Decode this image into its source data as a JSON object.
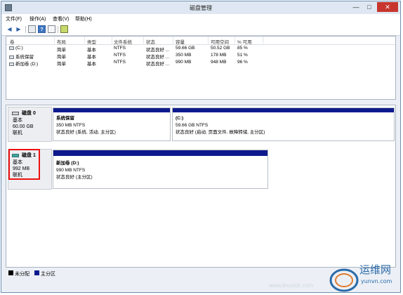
{
  "window": {
    "title": "磁盘管理",
    "minimize": "—",
    "maximize": "□",
    "close": "✕"
  },
  "menu": [
    "文件(F)",
    "操作(A)",
    "查看(V)",
    "帮助(H)"
  ],
  "toolbar_icons": [
    "back-icon",
    "forward-icon",
    "properties-icon",
    "help-icon",
    "disk-icon"
  ],
  "volume_list": {
    "columns": [
      "卷",
      "布局",
      "类型",
      "文件系统",
      "状态",
      "容量",
      "可用空间",
      "% 可用"
    ],
    "rows": [
      [
        "(C:)",
        "简单",
        "基本",
        "NTFS",
        "状态良好 ...",
        "59.66 GB",
        "50.52 GB",
        "85 %"
      ],
      [
        "系统保留",
        "简单",
        "基本",
        "NTFS",
        "状态良好 ...",
        "350 MB",
        "178 MB",
        "51 %"
      ],
      [
        "新加卷 (D:)",
        "简单",
        "基本",
        "NTFS",
        "状态良好 ...",
        "990 MB",
        "948 MB",
        "96 %"
      ]
    ]
  },
  "disks": [
    {
      "name": "磁盘 0",
      "type": "基本",
      "size": "60.00 GB",
      "status": "联机",
      "partitions": [
        {
          "name": "系统保留",
          "size": "350 MB NTFS",
          "status": "状态良好 (系统, 活动, 主分区)"
        },
        {
          "name": "(C:)",
          "size": "59.66 GB NTFS",
          "status": "状态良好 (启动, 页面文件, 故障转储, 主分区)"
        }
      ]
    },
    {
      "name": "磁盘 1",
      "type": "基本",
      "size": "992 MB",
      "status": "联机",
      "partitions": [
        {
          "name": "新加卷 (D:)",
          "size": "990 MB NTFS",
          "status": "状态良好 (主分区)"
        }
      ]
    }
  ],
  "legend": {
    "unallocated": "未分配",
    "primary": "主分区"
  },
  "colors": {
    "primary_partition": "#0e1a8c",
    "unallocated": "#000000",
    "highlight": "#e11111",
    "close_button": "#c7362e"
  },
  "watermark": {
    "text": "运维网",
    "url": "yunvn.com",
    "faint_url": "www.linuxidc.com"
  }
}
